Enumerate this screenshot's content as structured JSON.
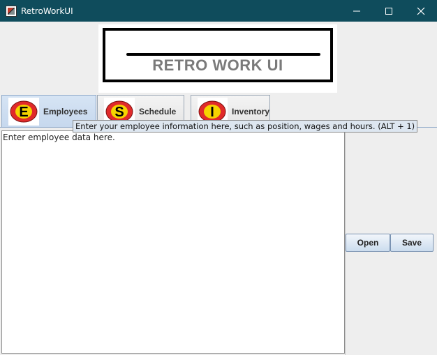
{
  "window": {
    "title": "RetroWorkUI",
    "icon": "app-icon",
    "controls": [
      "minimize-icon",
      "maximize-icon",
      "close-icon"
    ],
    "titlebar_color": "#0f4c5c"
  },
  "logo": {
    "text": "RETRO WORK UI"
  },
  "tabs": [
    {
      "letter": "E",
      "label": "Employees",
      "selected": true,
      "icon": "employees-icon"
    },
    {
      "letter": "S",
      "label": "Schedule",
      "selected": false,
      "icon": "schedule-icon"
    },
    {
      "letter": "I",
      "label": "Inventory",
      "selected": false,
      "icon": "inventory-icon"
    }
  ],
  "tooltip": {
    "text": "Enter your employee information here, such as position, wages and hours. (ALT + 1)"
  },
  "editor": {
    "value": "Enter employee data here."
  },
  "buttons": {
    "open_label": "Open",
    "save_label": "Save"
  },
  "colors": {
    "tab_icon_red": "#e02a2a",
    "tab_icon_yellow": "#f5d400",
    "selected_tab": "#c6d8ee"
  }
}
